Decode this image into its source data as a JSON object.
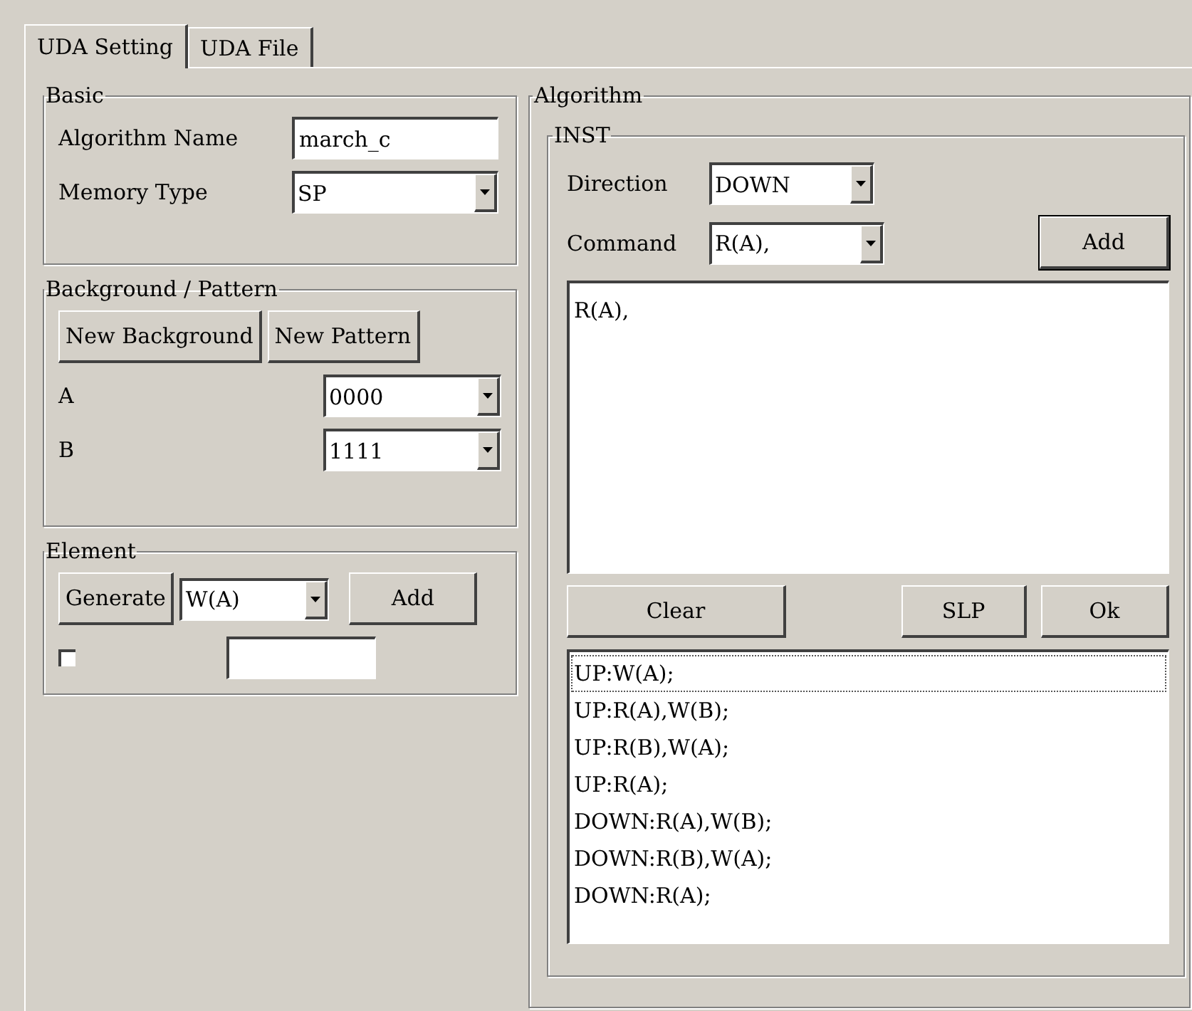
{
  "tabs": [
    {
      "label": "UDA Setting",
      "selected": true
    },
    {
      "label": "UDA File",
      "selected": false
    }
  ],
  "basic": {
    "title": "Basic",
    "algorithm_name": {
      "label": "Algorithm Name",
      "value": "march_c"
    },
    "memory_type": {
      "label": "Memory Type",
      "value": "SP"
    }
  },
  "background_pattern": {
    "title": "Background / Pattern",
    "buttons": [
      "New Background",
      "New Pattern"
    ],
    "rows": [
      {
        "label": "A",
        "value": "0000"
      },
      {
        "label": "B",
        "value": "1111"
      }
    ]
  },
  "element": {
    "title": "Element",
    "generate_button": "Generate",
    "command": {
      "value": "W(A)"
    },
    "add_button": "Add",
    "checkbox": {
      "checked": false
    }
  },
  "algorithm": {
    "title": "Algorithm",
    "inst": {
      "title": "INST",
      "direction": {
        "label": "Direction",
        "value": "DOWN"
      },
      "command": {
        "label": "Command",
        "value": "R(A),"
      },
      "add_button": "Add",
      "editor_text": "R(A),",
      "buttons": [
        "Clear",
        "SLP",
        "Ok"
      ],
      "list": [
        {
          "text": "UP:W(A);",
          "selected": false,
          "focused": true
        },
        {
          "text": "UP:R(A),W(B);",
          "selected": false,
          "focused": false
        },
        {
          "text": "UP:R(B),W(A);",
          "selected": false,
          "focused": false
        },
        {
          "text": "UP:R(A);",
          "selected": false,
          "focused": false
        },
        {
          "text": "DOWN:R(A),W(B);",
          "selected": false,
          "focused": false
        },
        {
          "text": "DOWN:R(B),W(A);",
          "selected": false,
          "focused": false
        },
        {
          "text": "DOWN:R(A);",
          "selected": false,
          "focused": false
        }
      ]
    }
  }
}
